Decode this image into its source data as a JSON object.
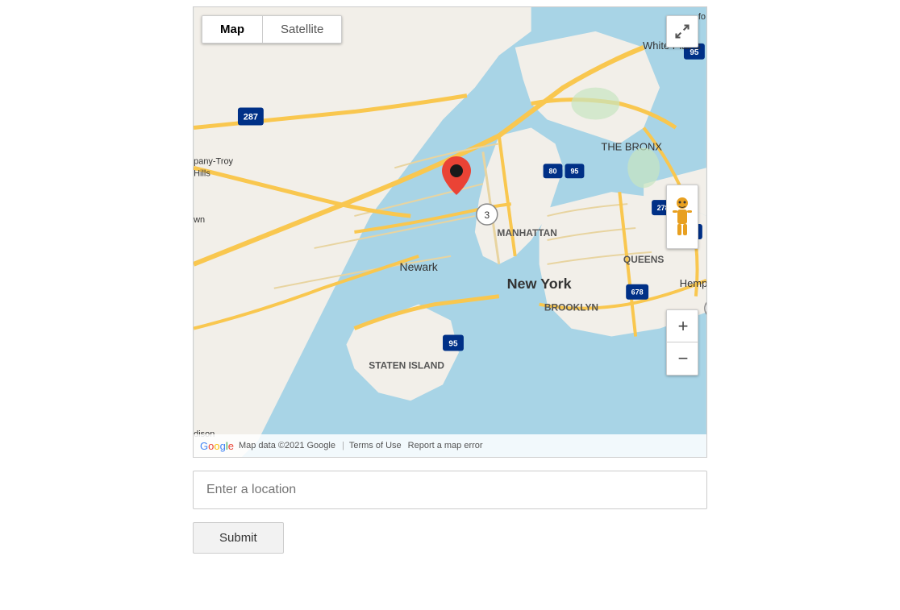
{
  "map": {
    "view_mode_active": "Map",
    "view_mode_inactive": "Satellite",
    "footer": {
      "data_text": "Map data ©2021 Google",
      "terms_link": "Terms of Use",
      "error_link": "Report a map error"
    },
    "zoom_in_label": "+",
    "zoom_out_label": "−",
    "fullscreen_title": "Toggle fullscreen"
  },
  "location_input": {
    "placeholder": "Enter a location",
    "value": ""
  },
  "submit_button": {
    "label": "Submit"
  },
  "google_logo": {
    "g": "G",
    "o1": "o",
    "o2": "o",
    "g2": "g",
    "l": "l",
    "e": "e"
  }
}
